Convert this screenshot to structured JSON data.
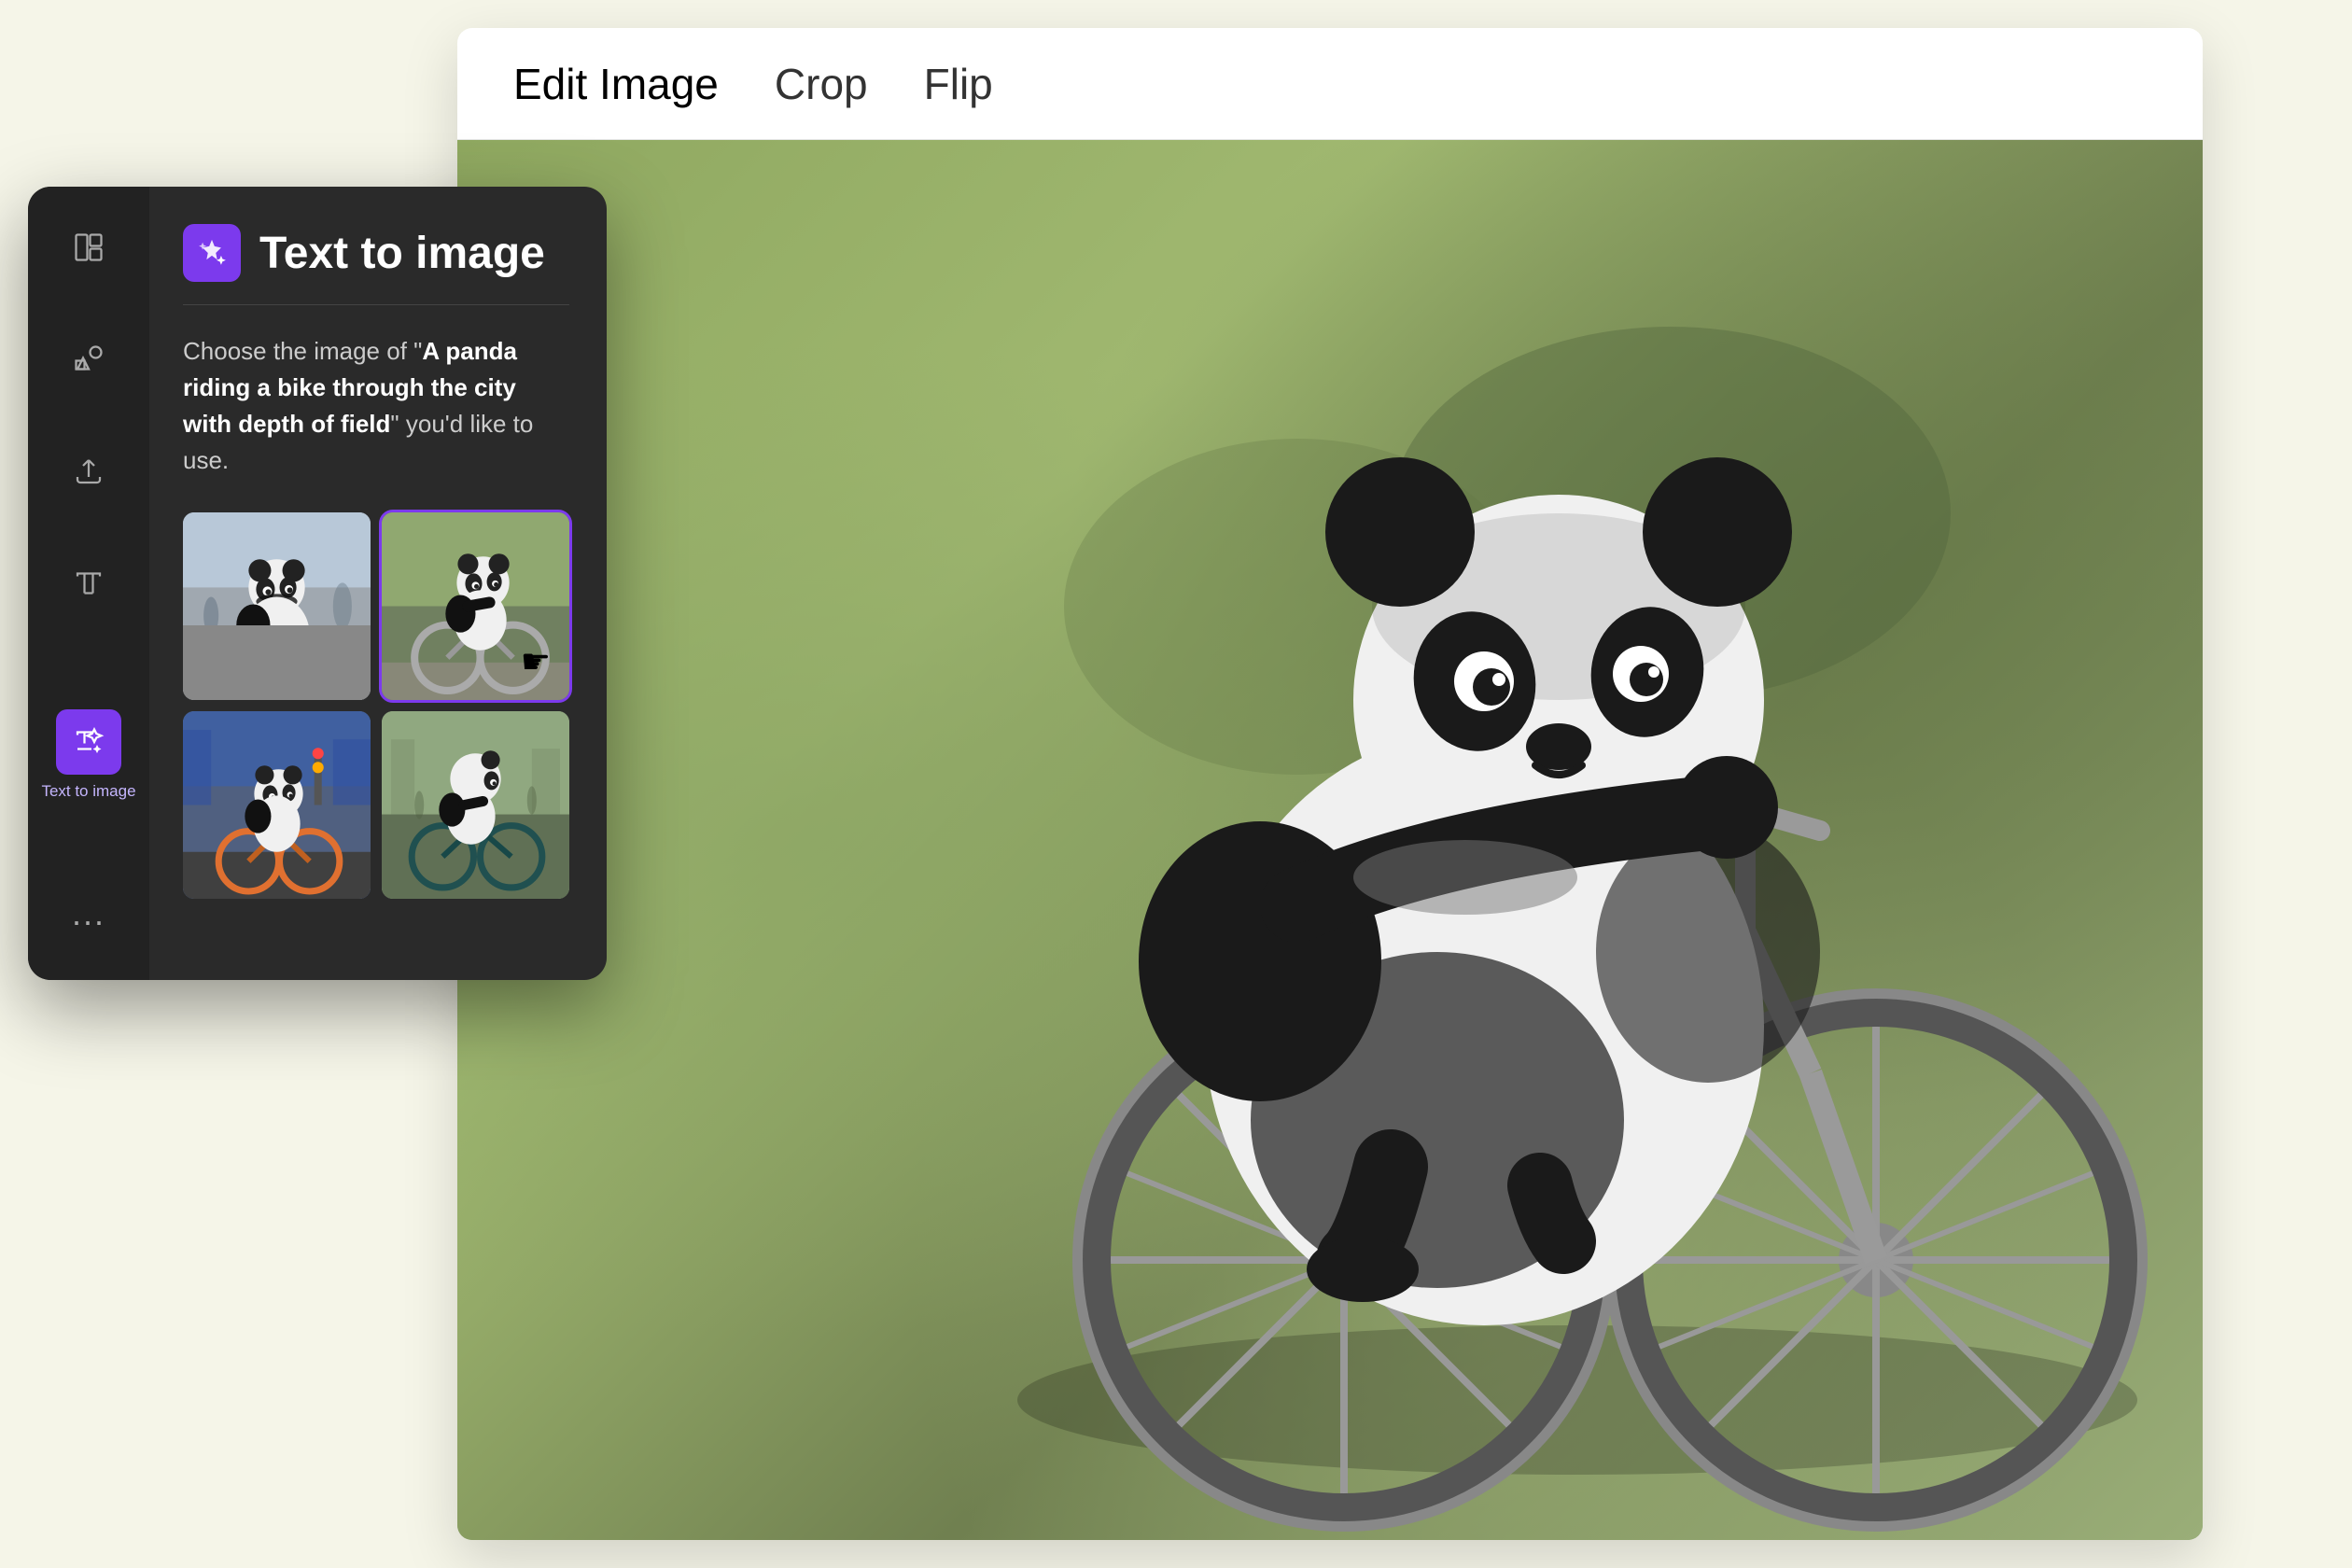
{
  "app": {
    "background_color": "#f5f5e8"
  },
  "editor": {
    "tabs": [
      {
        "id": "edit-image",
        "label": "Edit Image",
        "active": true
      },
      {
        "id": "crop",
        "label": "Crop",
        "active": false
      },
      {
        "id": "flip",
        "label": "Flip",
        "active": false
      }
    ]
  },
  "sidebar": {
    "title": "Text to image",
    "description_prefix": "Choose the image of “",
    "description_bold": "A panda riding a bike through the city with depth of field",
    "description_suffix": "” you’d like to use.",
    "ai_icon": "✨",
    "icons": [
      {
        "id": "layout",
        "label": "",
        "active": false,
        "symbol": "layout"
      },
      {
        "id": "shapes",
        "label": "",
        "active": false,
        "symbol": "shapes"
      },
      {
        "id": "upload",
        "label": "",
        "active": false,
        "symbol": "upload"
      },
      {
        "id": "text",
        "label": "",
        "active": false,
        "symbol": "text"
      },
      {
        "id": "text-to-image",
        "label": "Text to image",
        "active": true,
        "symbol": "ai"
      }
    ],
    "more_label": "..."
  },
  "image_grid": {
    "items": [
      {
        "id": "thumb-1",
        "alt": "Panda walking on city street",
        "selected": false
      },
      {
        "id": "thumb-2",
        "alt": "Panda riding bicycle side view",
        "selected": true
      },
      {
        "id": "thumb-3",
        "alt": "Panda on orange bike in city",
        "selected": false
      },
      {
        "id": "thumb-4",
        "alt": "Panda side view on teal bike",
        "selected": false
      }
    ]
  },
  "main_image": {
    "alt": "Selected panda riding bicycle - large view"
  }
}
